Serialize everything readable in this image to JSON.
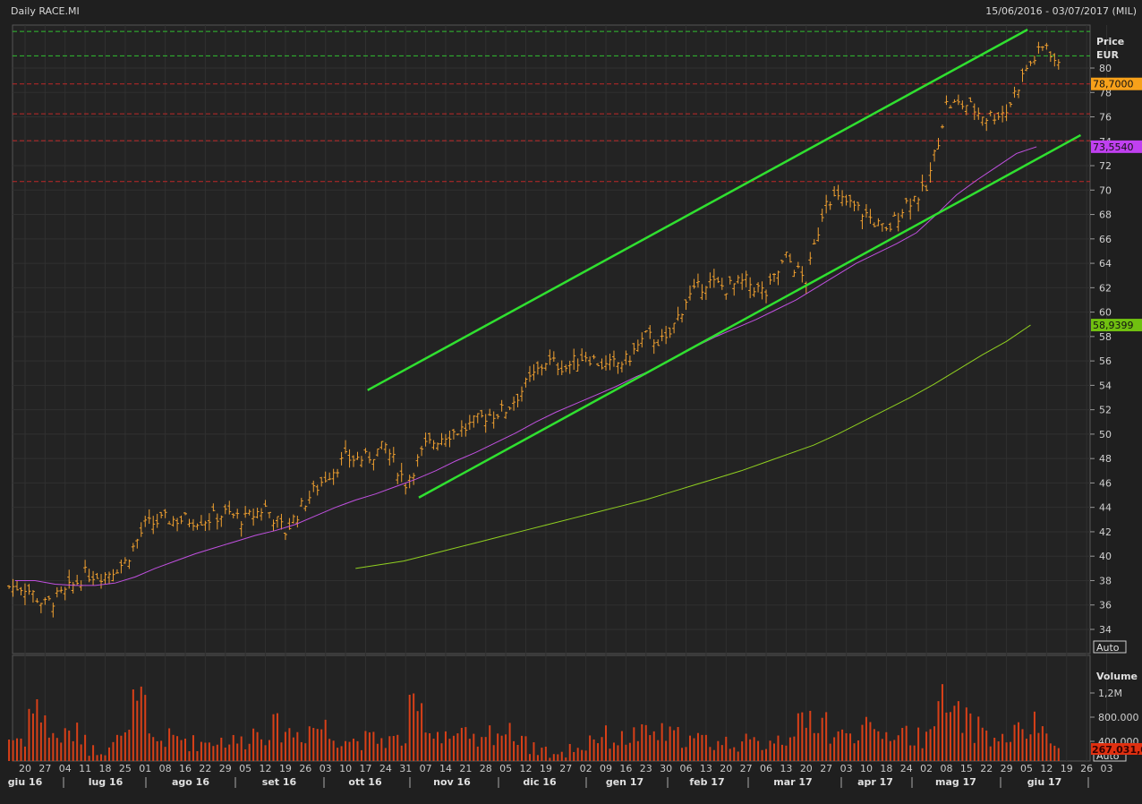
{
  "header": {
    "title": "Daily RACE.MI",
    "range": "15/06/2016 - 03/07/2017 (MIL)"
  },
  "price_axis": {
    "title": "Price",
    "currency": "EUR",
    "ticks": [
      80,
      78,
      76,
      74,
      72,
      70,
      68,
      66,
      64,
      62,
      60,
      58,
      56,
      54,
      52,
      50,
      48,
      46,
      44,
      42,
      40,
      38,
      36,
      34
    ],
    "auto_label": "Auto"
  },
  "volume_axis": {
    "title": "Volume",
    "ticks": [
      {
        "v": 1200000,
        "label": "1,2M"
      },
      {
        "v": 800000,
        "label": "800.000"
      },
      {
        "v": 400000,
        "label": "400.000"
      }
    ],
    "last_label": "267.031,0",
    "auto_label": "Auto"
  },
  "tags": {
    "last_price": "78,7000",
    "ma50": "73,5540",
    "ma200": "58,9399"
  },
  "colors": {
    "bg": "#1f1f1f",
    "price": "#f0a030",
    "ma50": "#c050e0",
    "ma200": "#90d020",
    "trend": "#30e030",
    "volume": "#d84018",
    "hline_red": "#c02828",
    "hline_green": "#30c030",
    "tag_price": "#f7a11a",
    "tag_ma50": "#c040f0",
    "tag_ma200": "#70c010",
    "tag_vol": "#e03010"
  },
  "chart_data": {
    "type": "ohlc",
    "title": "Daily RACE.MI",
    "xlabel": "",
    "ylabel": "Price EUR",
    "ylim": [
      32.5,
      84
    ],
    "x_ticks": [
      "20",
      "27",
      "04",
      "11",
      "18",
      "25",
      "01",
      "08",
      "16",
      "22",
      "29",
      "05",
      "12",
      "19",
      "26",
      "03",
      "10",
      "17",
      "24",
      "31",
      "07",
      "14",
      "21",
      "28",
      "05",
      "12",
      "19",
      "27",
      "02",
      "09",
      "16",
      "23",
      "30",
      "06",
      "13",
      "20",
      "27",
      "06",
      "13",
      "20",
      "27",
      "03",
      "10",
      "18",
      "24",
      "02",
      "08",
      "15",
      "22",
      "29",
      "05",
      "12",
      "19",
      "26",
      "03"
    ],
    "months": [
      "giu 16",
      "lug 16",
      "ago 16",
      "set 16",
      "ott 16",
      "nov 16",
      "dic 16",
      "gen 17",
      "feb 17",
      "mar 17",
      "apr 17",
      "mag 17",
      "giu 17"
    ],
    "weekly_close": [
      37.5,
      36,
      37,
      38.5,
      38.5,
      39.5,
      42.5,
      43,
      43,
      43,
      43.5,
      43,
      44,
      42,
      44.5,
      46.5,
      48,
      48,
      49,
      46,
      49,
      50,
      50.5,
      51.5,
      52,
      54,
      56,
      55.5,
      56.5,
      55.5,
      56,
      58,
      57.5,
      61,
      62.5,
      62,
      62.5,
      61.5,
      64.5,
      62.5,
      69.5,
      69,
      68,
      66.5,
      69,
      70,
      77,
      77,
      76,
      76.5,
      80,
      82,
      78.7
    ],
    "ma50_weekly": [
      38,
      38,
      37.7,
      37.6,
      37.6,
      37.8,
      38.3,
      39,
      39.6,
      40.2,
      40.7,
      41.2,
      41.7,
      42.1,
      42.6,
      43.3,
      44,
      44.6,
      45.1,
      45.7,
      46.3,
      47,
      47.8,
      48.5,
      49.3,
      50.1,
      51,
      51.8,
      52.5,
      53.2,
      53.9,
      54.7,
      55.4,
      56.3,
      57.2,
      58,
      58.7,
      59.4,
      60.2,
      61,
      62,
      63,
      64,
      64.8,
      65.6,
      66.5,
      68,
      69.6,
      70.8,
      71.9,
      73,
      73.55
    ],
    "ma200_weekly_from_index": 16.5,
    "ma200_weekly": [
      39,
      39.3,
      39.6,
      40.1,
      40.6,
      41.1,
      41.6,
      42.1,
      42.6,
      43.1,
      43.6,
      44.1,
      44.6,
      45.2,
      45.8,
      46.4,
      47,
      47.7,
      48.4,
      49.1,
      50,
      51,
      52,
      53,
      54.1,
      55.3,
      56.5,
      57.6,
      58.94
    ],
    "volume_weekly": [
      450000,
      900000,
      480000,
      520000,
      260000,
      420000,
      950000,
      420000,
      450000,
      380000,
      420000,
      400000,
      560000,
      620000,
      540000,
      640000,
      480000,
      420000,
      430000,
      420000,
      860000,
      560000,
      480000,
      380000,
      560000,
      520000,
      280000,
      180000,
      300000,
      480000,
      430000,
      500000,
      520000,
      480000,
      420000,
      380000,
      380000,
      360000,
      460000,
      640000,
      780000,
      480000,
      600000,
      520000,
      560000,
      460000,
      1000000,
      780000,
      620000,
      420000,
      540000,
      640000,
      267031
    ],
    "hlines": {
      "green": [
        83.0,
        81.0
      ],
      "red": [
        78.7,
        76.25,
        74.05,
        70.7
      ]
    },
    "trendlines": [
      {
        "from": [
          17.1,
          53.6
        ],
        "to": [
          50.05,
          83.15
        ]
      },
      {
        "from": [
          19.66,
          44.8
        ],
        "to": [
          52.7,
          74.5
        ]
      }
    ]
  }
}
